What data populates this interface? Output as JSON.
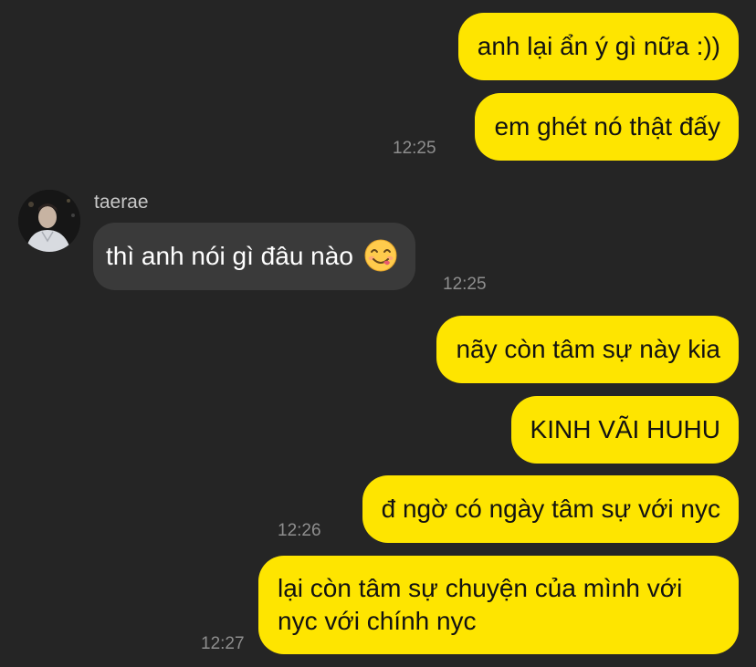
{
  "messages": [
    {
      "id": "m1",
      "direction": "outgoing",
      "text": "anh lại ẩn ý gì nữa :))"
    },
    {
      "id": "m2",
      "direction": "outgoing",
      "text": "em ghét nó thật đấy",
      "time": "12:25"
    },
    {
      "id": "m3",
      "direction": "incoming",
      "sender": "taerae",
      "text": "thì anh nói gì đâu nào",
      "emoji": "savoring-food-face-emoji",
      "time": "12:25"
    },
    {
      "id": "m4",
      "direction": "outgoing",
      "text": "nãy còn tâm sự này kia"
    },
    {
      "id": "m5",
      "direction": "outgoing",
      "text": "KINH VÃI HUHU"
    },
    {
      "id": "m6",
      "direction": "outgoing",
      "text": "đ ngờ có ngày tâm sự với nyc",
      "time": "12:26"
    },
    {
      "id": "m7",
      "direction": "outgoing",
      "lines": [
        "lại còn tâm sự chuyện của mình với",
        "nyc với chính nyc"
      ],
      "time": "12:27"
    }
  ],
  "colors": {
    "background": "#252525",
    "outgoing_bubble": "#fee500",
    "incoming_bubble": "#3a3a3a",
    "timestamp": "#8e8e8e"
  }
}
